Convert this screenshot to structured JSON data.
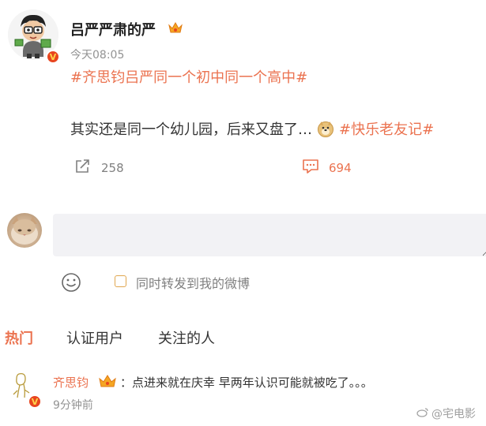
{
  "post": {
    "author": "吕严严肃的严",
    "time": "今天08:05",
    "topic_line": "#齐思钧吕严同一个初中同一个高中#",
    "text": "其实还是同一个幼儿园，后来又盘了…",
    "topic_inline": "#快乐老友记#",
    "share_count": "258",
    "comment_count": "694",
    "emoji_name": "doge-emoji"
  },
  "composer": {
    "placeholder": "",
    "checkbox_label": "同时转发到我的微博"
  },
  "tabs": [
    {
      "label": "热门",
      "active": true
    },
    {
      "label": "认证用户",
      "active": false
    },
    {
      "label": "关注的人",
      "active": false
    }
  ],
  "comment": {
    "name": "齐思钧",
    "text": "：点进来就在庆幸 早两年认识可能就被吃了。。。",
    "time": "9分钟前"
  },
  "watermark": "@宅电影",
  "colors": {
    "accent": "#eb7350",
    "verified": "#e8451f",
    "muted": "#939393",
    "input_bg": "#f2f2f5"
  }
}
